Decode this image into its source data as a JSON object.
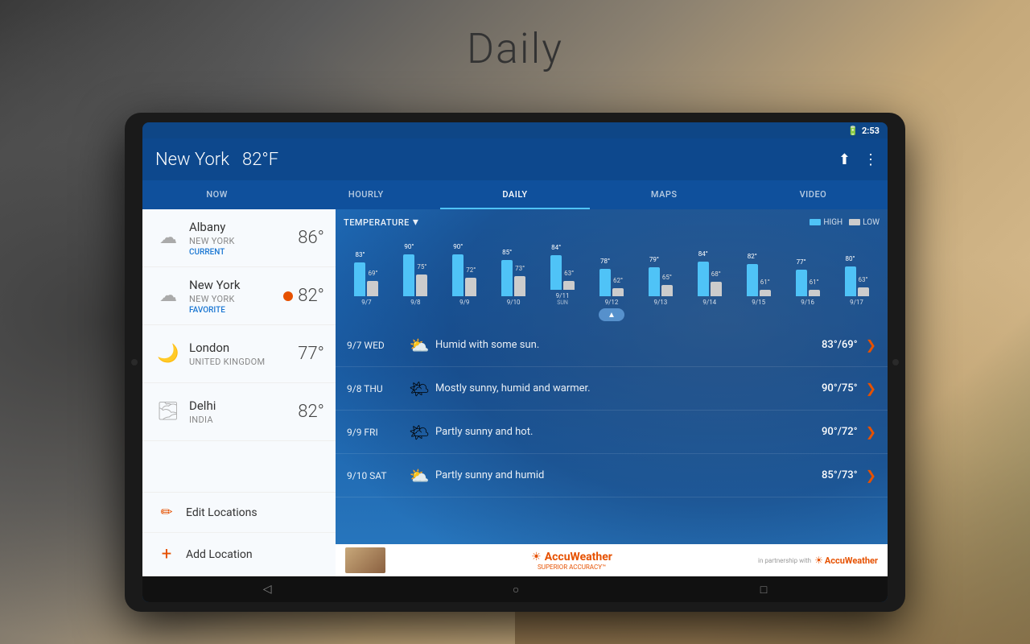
{
  "page": {
    "title": "Daily"
  },
  "status_bar": {
    "time": "2:53"
  },
  "header": {
    "city": "New York",
    "temp": "82°F",
    "share_icon": "⬆",
    "menu_icon": "⋮"
  },
  "nav_tabs": [
    {
      "label": "NOW",
      "active": false
    },
    {
      "label": "HOURLY",
      "active": false
    },
    {
      "label": "DAILY",
      "active": true
    },
    {
      "label": "MAPS",
      "active": false
    },
    {
      "label": "VIDEO",
      "active": false
    }
  ],
  "locations": [
    {
      "name": "Albany",
      "region": "NEW YORK",
      "tag": "CURRENT",
      "temp": "86°",
      "icon": "☁",
      "has_alert": false
    },
    {
      "name": "New York",
      "region": "NEW YORK",
      "tag": "FAVORITE",
      "temp": "82°",
      "icon": "☁",
      "has_alert": true
    },
    {
      "name": "London",
      "region": "UNITED KINGDOM",
      "tag": "",
      "temp": "77°",
      "icon": "🌙",
      "has_alert": false
    },
    {
      "name": "Delhi",
      "region": "INDIA",
      "tag": "",
      "temp": "82°",
      "icon": "🌫",
      "has_alert": false
    }
  ],
  "sidebar_actions": [
    {
      "id": "edit",
      "label": "Edit Locations",
      "icon": "✏"
    },
    {
      "id": "add",
      "label": "Add Location",
      "icon": "+"
    }
  ],
  "chart": {
    "label": "TEMPERATURE",
    "legend": {
      "high_label": "HIGH",
      "low_label": "LOW"
    },
    "bars": [
      {
        "date": "9/7",
        "day": "",
        "high": 83,
        "low": 69,
        "high_label": "83°",
        "low_label": "69°"
      },
      {
        "date": "9/8",
        "day": "",
        "high": 90,
        "low": 75,
        "high_label": "90°",
        "low_label": "75°"
      },
      {
        "date": "9/9",
        "day": "",
        "high": 90,
        "low": 72,
        "high_label": "90°",
        "low_label": "72°"
      },
      {
        "date": "9/10",
        "day": "",
        "high": 85,
        "low": 73,
        "high_label": "85°",
        "low_label": "73°"
      },
      {
        "date": "9/11",
        "day": "SUN",
        "high": 84,
        "low": 63,
        "high_label": "84°",
        "low_label": "63°"
      },
      {
        "date": "9/12",
        "day": "",
        "high": 78,
        "low": 62,
        "high_label": "78°",
        "low_label": "62°"
      },
      {
        "date": "9/13",
        "day": "",
        "high": 79,
        "low": 65,
        "high_label": "79°",
        "low_label": "65°"
      },
      {
        "date": "9/14",
        "day": "",
        "high": 84,
        "low": 68,
        "high_label": "84°",
        "low_label": "68°"
      },
      {
        "date": "9/15",
        "day": "",
        "high": 82,
        "low": 61,
        "high_label": "82°",
        "low_label": "61°"
      },
      {
        "date": "9/16",
        "day": "",
        "high": 77,
        "low": 61,
        "high_label": "77°",
        "low_label": "61°"
      },
      {
        "date": "9/17",
        "day": "",
        "high": 80,
        "low": 63,
        "high_label": "80°",
        "low_label": "63°"
      }
    ]
  },
  "daily_forecast": [
    {
      "date": "9/7 WED",
      "icon": "⛅🌧",
      "desc": "Humid with some sun.",
      "high": "83°",
      "low": "69°"
    },
    {
      "date": "9/8 THU",
      "icon": "⛅",
      "desc": "Mostly sunny, humid and warmer.",
      "high": "90°",
      "low": "75°"
    },
    {
      "date": "9/9 FRI",
      "icon": "🌤",
      "desc": "Partly sunny and hot.",
      "high": "90°",
      "low": "72°"
    },
    {
      "date": "9/10 SAT",
      "icon": "⛅",
      "desc": "Partly sunny and humid",
      "high": "85°",
      "low": "73°"
    }
  ],
  "accu": {
    "logo": "AccuWeather",
    "tagline": "SUPERIOR ACCURACY™",
    "partnership": "in partnership with"
  }
}
